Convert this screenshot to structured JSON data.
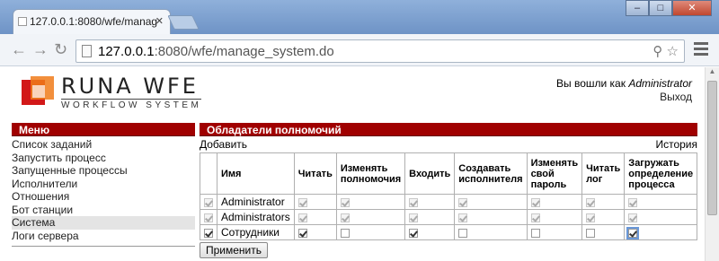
{
  "browser": {
    "tab_title": "127.0.0.1:8080/wfe/manag",
    "url_host": "127.0.0.1",
    "url_rest": ":8080/wfe/manage_system.do"
  },
  "header": {
    "logo_title": "RUNA WFE",
    "logo_subtitle": "WORKFLOW SYSTEM",
    "logged_in_prefix": "Вы вошли как ",
    "user_name": "Administrator",
    "logout_label": "Выход"
  },
  "menu": {
    "title": "Меню",
    "items": [
      {
        "label": "Список заданий"
      },
      {
        "label": "Запустить процесс"
      },
      {
        "label": "Запущенные процессы"
      },
      {
        "label": "Исполнители"
      },
      {
        "label": "Отношения"
      },
      {
        "label": "Бот станции"
      },
      {
        "label": "Система",
        "active": true
      },
      {
        "label": "Логи сервера"
      }
    ]
  },
  "content": {
    "title": "Обладатели полномочий",
    "add_label": "Добавить",
    "history_label": "История",
    "columns": [
      "",
      "Имя",
      "Читать",
      "Изменять полномочия",
      "Входить",
      "Создавать исполнителя",
      "Изменять свой пароль",
      "Читать лог",
      "Загружать определение процесса"
    ],
    "rows": [
      {
        "name": "Administrator",
        "select": {
          "checked": true,
          "disabled": true
        },
        "perms": [
          {
            "checked": true,
            "disabled": true
          },
          {
            "checked": true,
            "disabled": true
          },
          {
            "checked": true,
            "disabled": true
          },
          {
            "checked": true,
            "disabled": true
          },
          {
            "checked": true,
            "disabled": true
          },
          {
            "checked": true,
            "disabled": true
          },
          {
            "checked": true,
            "disabled": true
          }
        ]
      },
      {
        "name": "Administrators",
        "select": {
          "checked": true,
          "disabled": true
        },
        "perms": [
          {
            "checked": true,
            "disabled": true
          },
          {
            "checked": true,
            "disabled": true
          },
          {
            "checked": true,
            "disabled": true
          },
          {
            "checked": true,
            "disabled": true
          },
          {
            "checked": true,
            "disabled": true
          },
          {
            "checked": true,
            "disabled": true
          },
          {
            "checked": true,
            "disabled": true
          }
        ]
      },
      {
        "name": "Сотрудники",
        "select": {
          "checked": true,
          "disabled": false
        },
        "perms": [
          {
            "checked": true,
            "disabled": false
          },
          {
            "checked": false,
            "disabled": false
          },
          {
            "checked": true,
            "disabled": false
          },
          {
            "checked": false,
            "disabled": false
          },
          {
            "checked": false,
            "disabled": false
          },
          {
            "checked": false,
            "disabled": false
          },
          {
            "checked": true,
            "disabled": false,
            "focused": true
          }
        ]
      }
    ],
    "apply_label": "Применить"
  },
  "colors": {
    "accent": "#a00000",
    "logo_red": "#d21818",
    "logo_orange": "#f07b1a"
  }
}
